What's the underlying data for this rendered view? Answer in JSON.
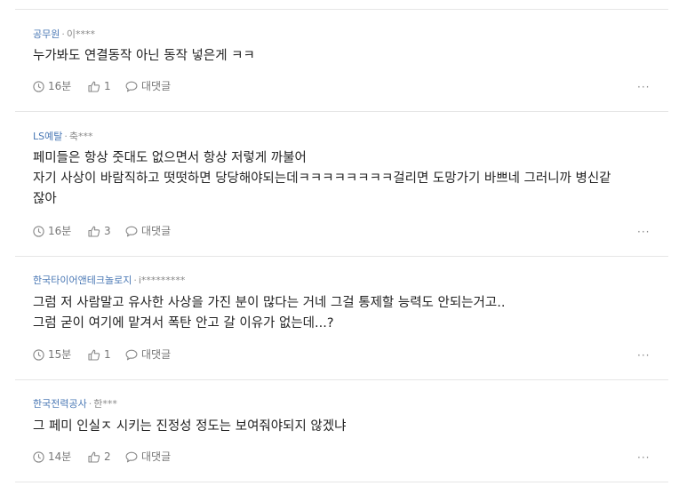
{
  "comments": [
    {
      "company": "공무원",
      "author": "이****",
      "lines": [
        "누가봐도 연결동작 아닌 동작 넣은게 ㅋㅋ"
      ],
      "time": "16분",
      "likes": "1",
      "reply_label": "대댓글",
      "more_label": "···"
    },
    {
      "company": "LS예탈",
      "author": "축***",
      "lines": [
        "페미들은 항상 줏대도 없으면서 항상 저렇게 까불어",
        "자기 사상이 바람직하고 떳떳하면 당당해야되는데ㅋㅋㅋㅋㅋㅋㅋㅋ걸리면 도망가기 바쁘네 그러니까 병신같",
        "잖아"
      ],
      "time": "16분",
      "likes": "3",
      "reply_label": "대댓글",
      "more_label": "···"
    },
    {
      "company": "한국타이어앤테크놀로지",
      "author": "i*********",
      "lines": [
        "그럼 저 사람말고 유사한 사상을 가진 분이 많다는 거네 그걸 통제할 능력도 안되는거고..",
        "그럼 굳이 여기에 맡겨서 폭탄 안고 갈 이유가 없는데...?"
      ],
      "time": "15분",
      "likes": "1",
      "reply_label": "대댓글",
      "more_label": "···"
    },
    {
      "company": "한국전력공사",
      "author": "한***",
      "lines": [
        "그 페미 인실ㅈ 시키는 진정성 정도는 보여줘야되지 않겠냐"
      ],
      "time": "14분",
      "likes": "2",
      "reply_label": "대댓글",
      "more_label": "···"
    }
  ]
}
